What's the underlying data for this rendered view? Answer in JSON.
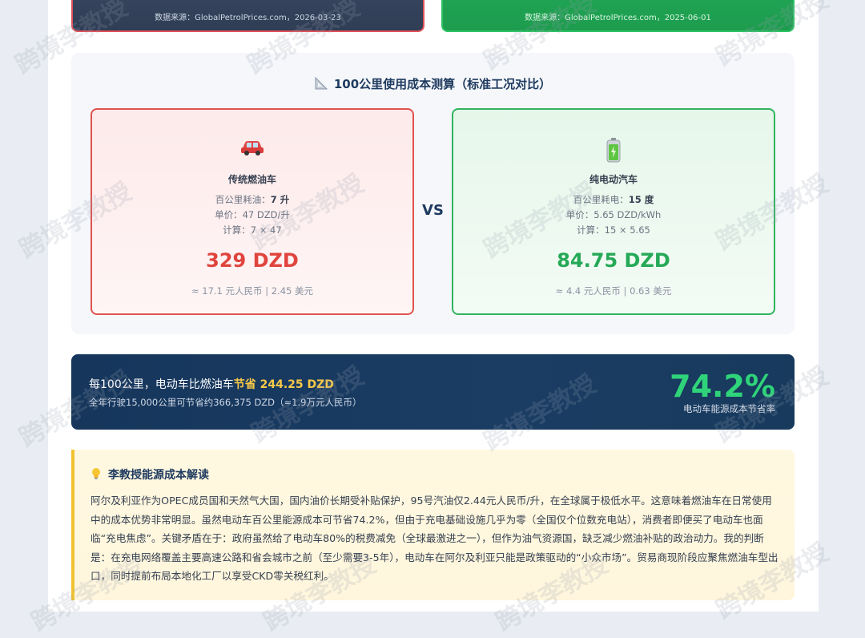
{
  "top_cards": {
    "left_source": "数据来源：GlobalPetrolPrices.com，2026-03-23",
    "right_source": "数据来源：GlobalPetrolPrices.com，2025-06-01"
  },
  "calc": {
    "title": "100公里使用成本测算（标准工况对比）",
    "vs": "VS",
    "fuel": {
      "name": "传统燃油车",
      "consumption_label": "百公里耗油：",
      "consumption_value": "7 升",
      "price": "单价：47 DZD/升",
      "formula": "计算：7 × 47",
      "cost": "329 DZD",
      "conversion": "≈ 17.1 元人民币 | 2.45 美元"
    },
    "ev": {
      "name": "纯电动汽车",
      "consumption_label": "百公里耗电：",
      "consumption_value": "15 度",
      "price": "单价：5.65 DZD/kWh",
      "formula": "计算：15 × 5.65",
      "cost": "84.75 DZD",
      "conversion": "≈ 4.4 元人民币 | 0.63 美元"
    }
  },
  "banner": {
    "headline_prefix": "每100公里，电动车比燃油车",
    "headline_highlight": "节省 244.25 DZD",
    "sub": "全年行驶15,000公里可节省约366,375 DZD（≈1.9万元人民币）",
    "percent": "74.2%",
    "percent_label": "电动车能源成本节省率"
  },
  "analysis": {
    "title": "李教授能源成本解读",
    "body": "阿尔及利亚作为OPEC成员国和天然气大国，国内油价长期受补贴保护，95号汽油仅2.44元人民币/升，在全球属于极低水平。这意味着燃油车在日常使用中的成本优势非常明显。虽然电动车百公里能源成本可节省74.2%，但由于充电基础设施几乎为零（全国仅个位数充电站），消费者即便买了电动车也面临“充电焦虑”。关键矛盾在于：政府虽然给了电动车80%的税费减免（全球最激进之一），但作为油气资源国，缺乏减少燃油补贴的政治动力。我的判断是：在充电网络覆盖主要高速公路和省会城市之前（至少需要3-5年），电动车在阿尔及利亚只能是政策驱动的“小众市场”。贸易商现阶段应聚焦燃油车型出口，同时提前布局本地化工厂以享受CKD零关税红利。"
  },
  "watermark": "跨境李教授",
  "colors": {
    "fuel_accent": "#e0443e",
    "ev_accent": "#25a957",
    "highlight": "#f7c948",
    "navy": "#1e3a5f"
  }
}
